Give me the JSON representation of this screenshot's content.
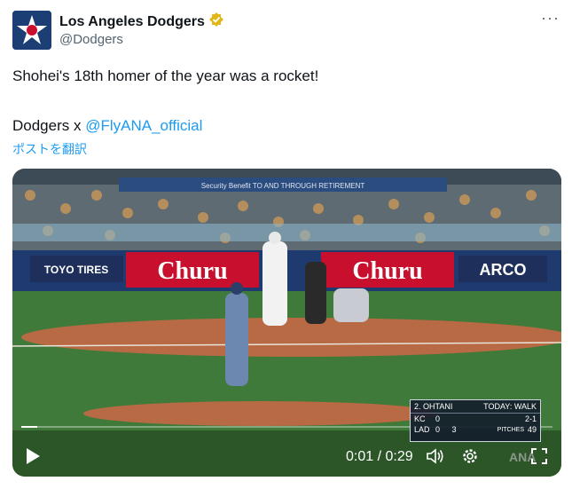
{
  "account": {
    "display_name": "Los Angeles Dodgers",
    "handle": "@Dodgers",
    "verified": true,
    "verified_color": "#e2b719",
    "more_label": "···"
  },
  "tweet": {
    "line1": "Shohei's 18th homer of the year was a rocket!",
    "line2_prefix": "Dodgers x ",
    "mention": "@FlyANA_official",
    "translate_label": "ポストを翻訳"
  },
  "video": {
    "current_time": "0:01",
    "separator": " / ",
    "duration": "0:29",
    "progress": 0.03,
    "play_icon": "play-icon",
    "volume_icon": "volume-icon",
    "settings_icon": "gear-icon",
    "fullscreen_icon": "fullscreen-icon",
    "ad_boards": {
      "left": "TOYO TIRES",
      "center": "Churu",
      "center_right": "Churu",
      "right": "ARCO",
      "upper": "Security Benefit  TO AND THROUGH RETIREMENT"
    },
    "scoreboard": {
      "batter": "2. OHTANI",
      "today": "TODAY: WALK",
      "team1": "KC",
      "score1": "0",
      "team2": "LAD",
      "score2": "0",
      "inning": "3",
      "count": "2-1",
      "pitches_label": "PITCHES",
      "pitches": "49"
    },
    "watermark": "ANA"
  }
}
